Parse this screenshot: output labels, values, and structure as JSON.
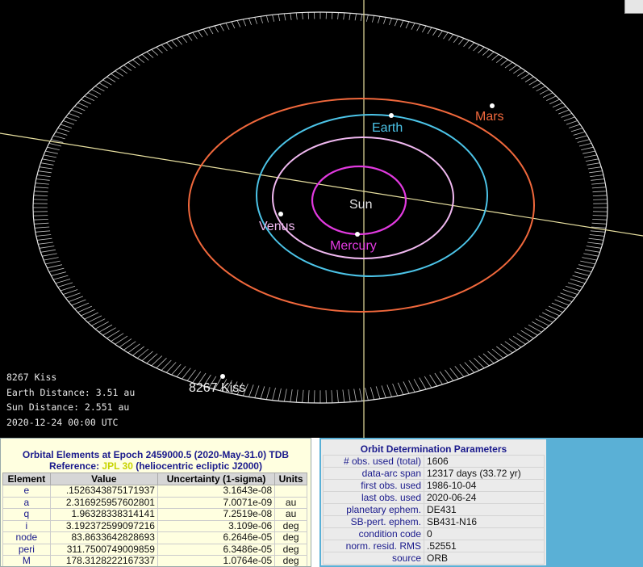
{
  "orbit_view": {
    "labels": {
      "sun": "Sun",
      "mercury": "Mercury",
      "venus": "Venus",
      "earth": "Earth",
      "mars": "Mars",
      "asteroid": "8267 Kiss"
    },
    "colors": {
      "mercury": "#e23ae0",
      "venus": "#f0b8f0",
      "earth": "#4cc4e8",
      "mars": "#f0683c",
      "asteroid_orbit": "#e8e8e8",
      "axis": "#e8e0a0"
    },
    "info": {
      "name": "8267 Kiss",
      "earth_distance": "Earth Distance: 3.51 au",
      "sun_distance": "Sun Distance: 2.551 au",
      "date": "2020-12-24 00:00 UTC"
    }
  },
  "orbital_elements": {
    "title": "Orbital Elements at Epoch 2459000.5 (2020-May-31.0) TDB",
    "reference_prefix": "Reference: ",
    "reference_link": "JPL 30",
    "reference_suffix": " (heliocentric ecliptic J2000)",
    "columns": [
      "Element",
      "Value",
      "Uncertainty (1-sigma)",
      "Units"
    ],
    "rows": [
      {
        "element": "e",
        "value": ".1526343875171937",
        "uncertainty": "3.1643e-08",
        "units": ""
      },
      {
        "element": "a",
        "value": "2.316925957602801",
        "uncertainty": "7.0071e-09",
        "units": "au"
      },
      {
        "element": "q",
        "value": "1.96328338314141",
        "uncertainty": "7.2519e-08",
        "units": "au"
      },
      {
        "element": "i",
        "value": "3.192372599097216",
        "uncertainty": "3.109e-06",
        "units": "deg"
      },
      {
        "element": "node",
        "value": "83.8633642828693",
        "uncertainty": "6.2646e-05",
        "units": "deg"
      },
      {
        "element": "peri",
        "value": "311.7500749009859",
        "uncertainty": "6.3486e-05",
        "units": "deg"
      },
      {
        "element": "M",
        "value": "178.3128222167337",
        "uncertainty": "1.0764e-05",
        "units": "deg"
      }
    ]
  },
  "orbit_determination": {
    "title": "Orbit Determination Parameters",
    "rows": [
      {
        "key": "# obs. used (total)",
        "value": "1606"
      },
      {
        "key": "data-arc span",
        "value": "12317 days (33.72 yr)"
      },
      {
        "key": "first obs. used",
        "value": "1986-10-04"
      },
      {
        "key": "last obs. used",
        "value": "2020-06-24"
      },
      {
        "key": "planetary ephem.",
        "value": "DE431"
      },
      {
        "key": "SB-pert. ephem.",
        "value": "SB431-N16"
      },
      {
        "key": "condition code",
        "value": "0"
      },
      {
        "key": "norm. resid. RMS",
        "value": ".52551"
      },
      {
        "key": "source",
        "value": "ORB"
      }
    ]
  }
}
